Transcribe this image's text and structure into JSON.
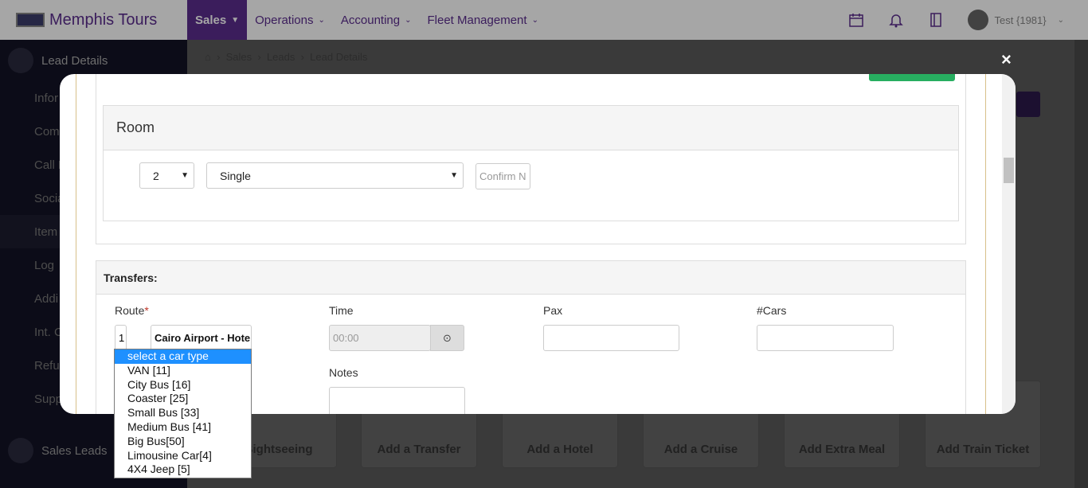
{
  "app": {
    "name": "Memphis Tours"
  },
  "nav": {
    "items": [
      {
        "label": "Sales",
        "active": true
      },
      {
        "label": "Operations",
        "active": false
      },
      {
        "label": "Accounting",
        "active": false
      },
      {
        "label": "Fleet Management",
        "active": false
      }
    ],
    "user": "Test {1981}",
    "icons": [
      "calendar-icon",
      "bell-icon",
      "notebook-icon"
    ]
  },
  "sidebar": {
    "title": "Lead Details",
    "items": [
      "Infor",
      "Comm",
      "Call L",
      "Socia",
      "Item",
      "Log",
      "Addi",
      "Int. C",
      "Refu",
      "Supp"
    ],
    "bottom": "Sales Leads"
  },
  "breadcrumb": [
    "Sales",
    "Leads",
    "Lead Details"
  ],
  "background_cards": [
    "Sightseeing",
    "Add a Transfer",
    "Add a Hotel",
    "Add a Cruise",
    "Add Extra Meal",
    "Add Train Ticket"
  ],
  "modal": {
    "room": {
      "title": "Room",
      "count_value": "2",
      "type_value": "Single",
      "confirm_placeholder": "Confirm N"
    },
    "transfers": {
      "title": "Transfers:",
      "route_label": "Route",
      "route_required": "*",
      "route_num": "1",
      "route_value": "Cairo Airport - Hotel",
      "time_label": "Time",
      "time_placeholder": "00:00",
      "pax_label": "Pax",
      "cars_label": "#Cars",
      "notes_label": "Notes"
    },
    "car_type_options": [
      "select a car type",
      "VAN [11]",
      "City Bus [16]",
      "Coaster [25]",
      "Small Bus [33]",
      "Medium Bus [41]",
      "Big Bus[50]",
      "Limousine Car[4]",
      "4X4 Jeep [5]"
    ],
    "highlighted_option": "select a car type",
    "close_symbol": "×"
  },
  "colors": {
    "brand": "#5b2d8e",
    "success": "#27ae60",
    "highlight": "#1e90ff"
  }
}
